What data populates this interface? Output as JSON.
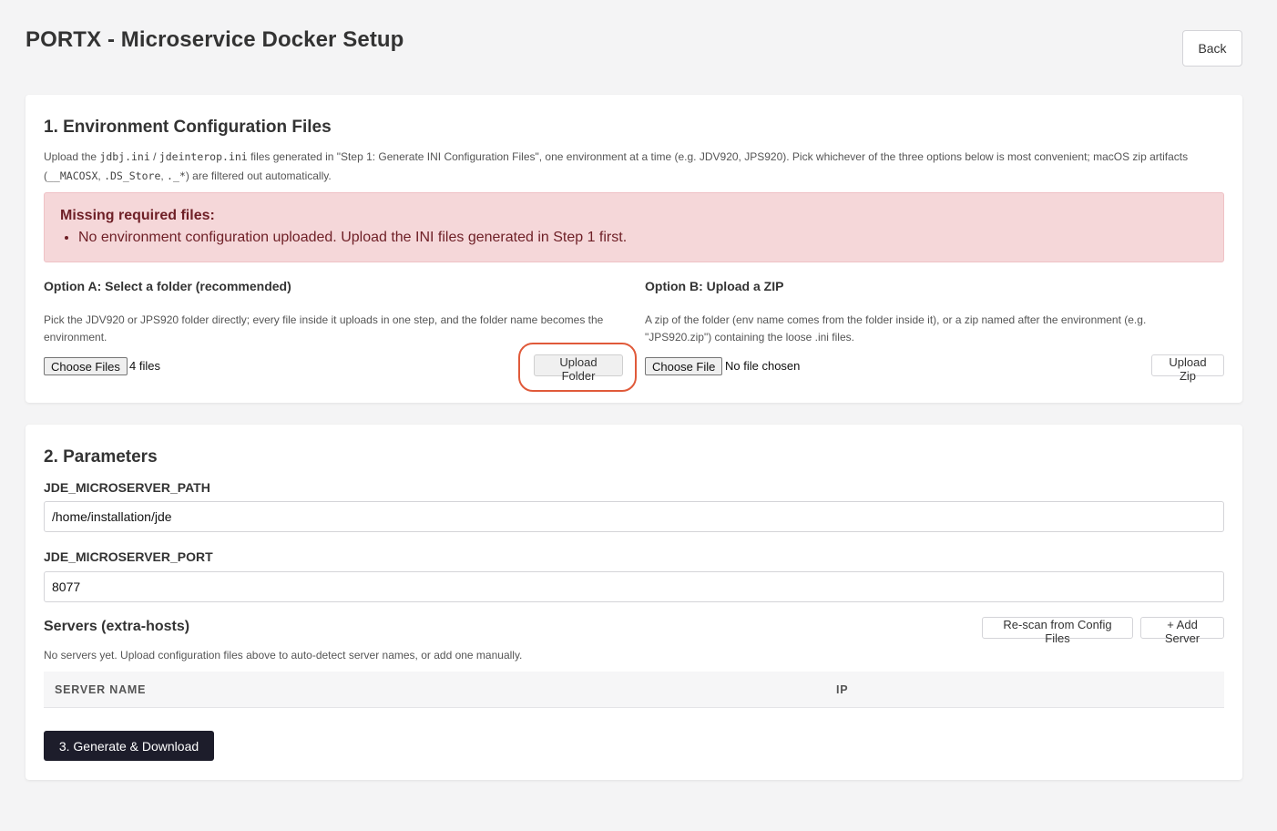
{
  "header": {
    "title": "PORTX - Microservice Docker Setup",
    "back_label": "Back"
  },
  "env_config": {
    "title": "1. Environment Configuration Files",
    "desc": {
      "t1": "Upload the ",
      "c1": "jdbj.ini",
      "t2": " / ",
      "c2": "jdeinterop.ini",
      "t3": " files generated in \"Step 1: Generate INI Configuration Files\", one environment at a time (e.g. JDV920, JPS920). Pick whichever of the three options below is most convenient; macOS zip artifacts (",
      "c3": "__MACOSX",
      "t4": ", ",
      "c4": ".DS_Store",
      "t5": ", ",
      "c5": "._*",
      "t6": ") are filtered out automatically."
    },
    "alert": {
      "title": "Missing required files:",
      "items": [
        "No environment configuration uploaded. Upload the INI files generated in Step 1 first."
      ]
    },
    "option_a": {
      "title": "Option A: Select a folder (recommended)",
      "desc": "Pick the JDV920 or JPS920 folder directly; every file inside it uploads in one step, and the folder name becomes the environment.",
      "choose_label": "Choose Files",
      "status": "4 files",
      "upload_label": "Upload Folder"
    },
    "option_b": {
      "title": "Option B: Upload a ZIP",
      "desc": "A zip of the folder (env name comes from the folder inside it), or a zip named after the environment (e.g. \"JPS920.zip\") containing the loose .ini files.",
      "choose_label": "Choose File",
      "status": "No file chosen",
      "upload_label": "Upload Zip"
    }
  },
  "parameters": {
    "title": "2. Parameters",
    "path_label": "JDE_MICROSERVER_PATH",
    "path_value": "/home/installation/jde",
    "port_label": "JDE_MICROSERVER_PORT",
    "port_value": "8077",
    "servers": {
      "title": "Servers (extra-hosts)",
      "rescan_label": "Re-scan from Config Files",
      "add_label": "+ Add Server",
      "note": "No servers yet. Upload configuration files above to auto-detect server names, or add one manually.",
      "columns": [
        "SERVER NAME",
        "IP"
      ]
    },
    "generate_label": "3. Generate & Download"
  },
  "colors": {
    "accent_dark": "#1d1d2b",
    "alert_bg": "#f5d7d9",
    "alert_text": "#6e1f26",
    "highlight": "#e05a3a"
  }
}
